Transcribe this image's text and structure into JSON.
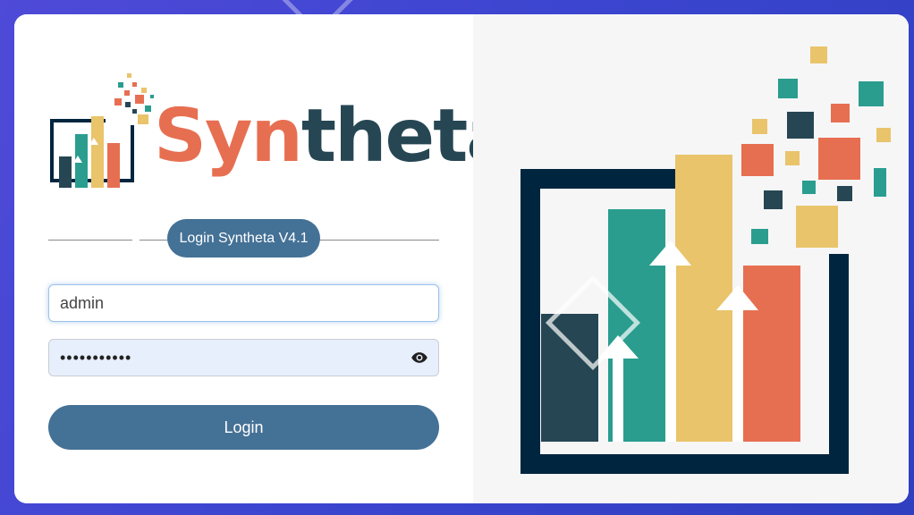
{
  "brand": {
    "name_part_1": "Syn",
    "name_part_2": "theta",
    "colors": {
      "dark": "#264653",
      "teal": "#2a9d8f",
      "yellow": "#e9c46a",
      "orange": "#e76f51",
      "navy": "#00263f",
      "primary": "#447196"
    }
  },
  "login": {
    "title": "Login Syntheta V4.1",
    "username_value": "admin",
    "password_value": "•••••••••••",
    "show_password_icon": "eye-icon",
    "submit_label": "Login"
  }
}
